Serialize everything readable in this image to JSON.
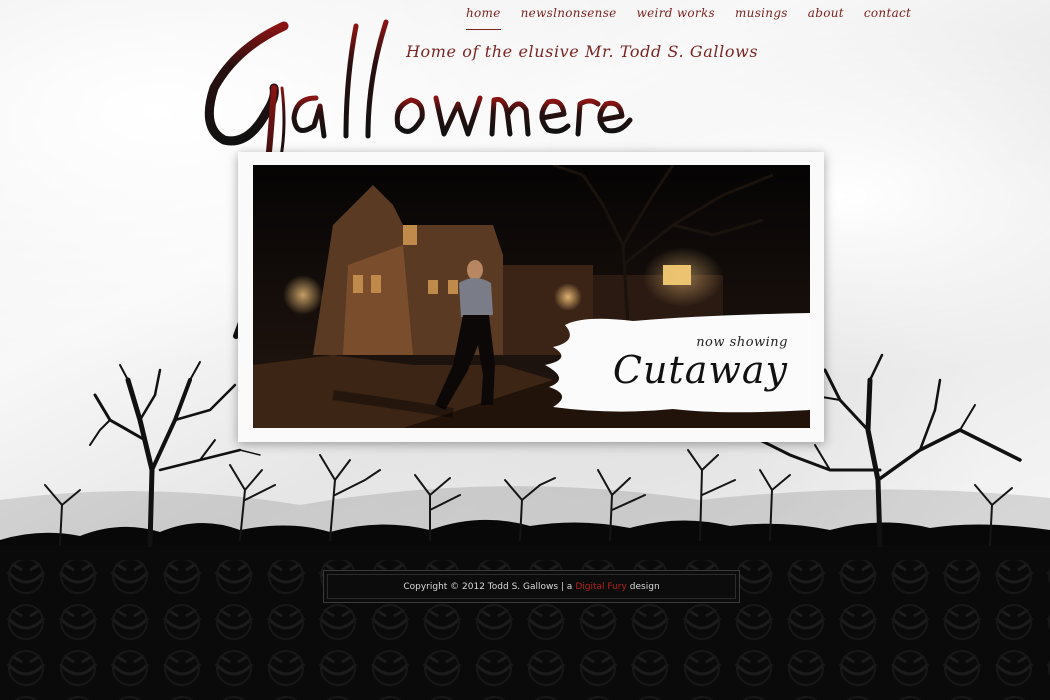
{
  "nav": {
    "items": [
      {
        "label": "home",
        "active": true
      },
      {
        "label": "newslnonsense",
        "active": false
      },
      {
        "label": "weird works",
        "active": false
      },
      {
        "label": "musings",
        "active": false
      },
      {
        "label": "about",
        "active": false
      },
      {
        "label": "contact",
        "active": false
      }
    ]
  },
  "header": {
    "logo_text": "Gallowmere",
    "tagline": "Home of the elusive Mr. Todd S. Gallows"
  },
  "feature": {
    "kicker": "now showing",
    "title": "Cutaway"
  },
  "footer": {
    "prefix": "Copyright © 2012 Todd S. Gallows | a",
    "link": "Digital Fury",
    "suffix": "design"
  },
  "colors": {
    "accent": "#7b1f1f",
    "footer_link": "#b3211c",
    "ground": "#0c0c0c"
  }
}
